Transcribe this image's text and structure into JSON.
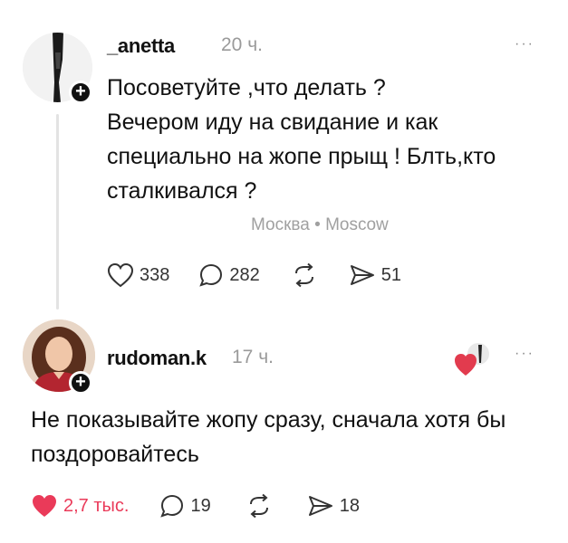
{
  "post1": {
    "username": "_anetta",
    "time": "20 ч.",
    "more": "···",
    "lines": [
      "Посоветуйте ,что делать ?",
      "Вечером иду на свидание и как",
      "специально на жопе прыщ ! Блть,кто",
      "сталкивался ?"
    ],
    "location": "Москва • Moscow",
    "likes": "338",
    "comments": "282",
    "shares": "51"
  },
  "post2": {
    "username": "rudoman.k",
    "time": "17 ч.",
    "more": "···",
    "lines": [
      "Не показывайте жопу сразу, сначала хотя бы",
      "поздоровайтесь"
    ],
    "likes": "2,7 тыс.",
    "comments": "19",
    "shares": "18"
  },
  "icons": {
    "like": "heart-outline-icon",
    "liked": "heart-filled-icon",
    "comment": "comment-bubble-icon",
    "repost": "repost-arrows-icon",
    "share": "send-arrow-icon",
    "follow": "plus-icon"
  },
  "colors": {
    "like_active": "#ea3a59",
    "meta_gray": "#9a9a9a",
    "text": "#111111"
  }
}
